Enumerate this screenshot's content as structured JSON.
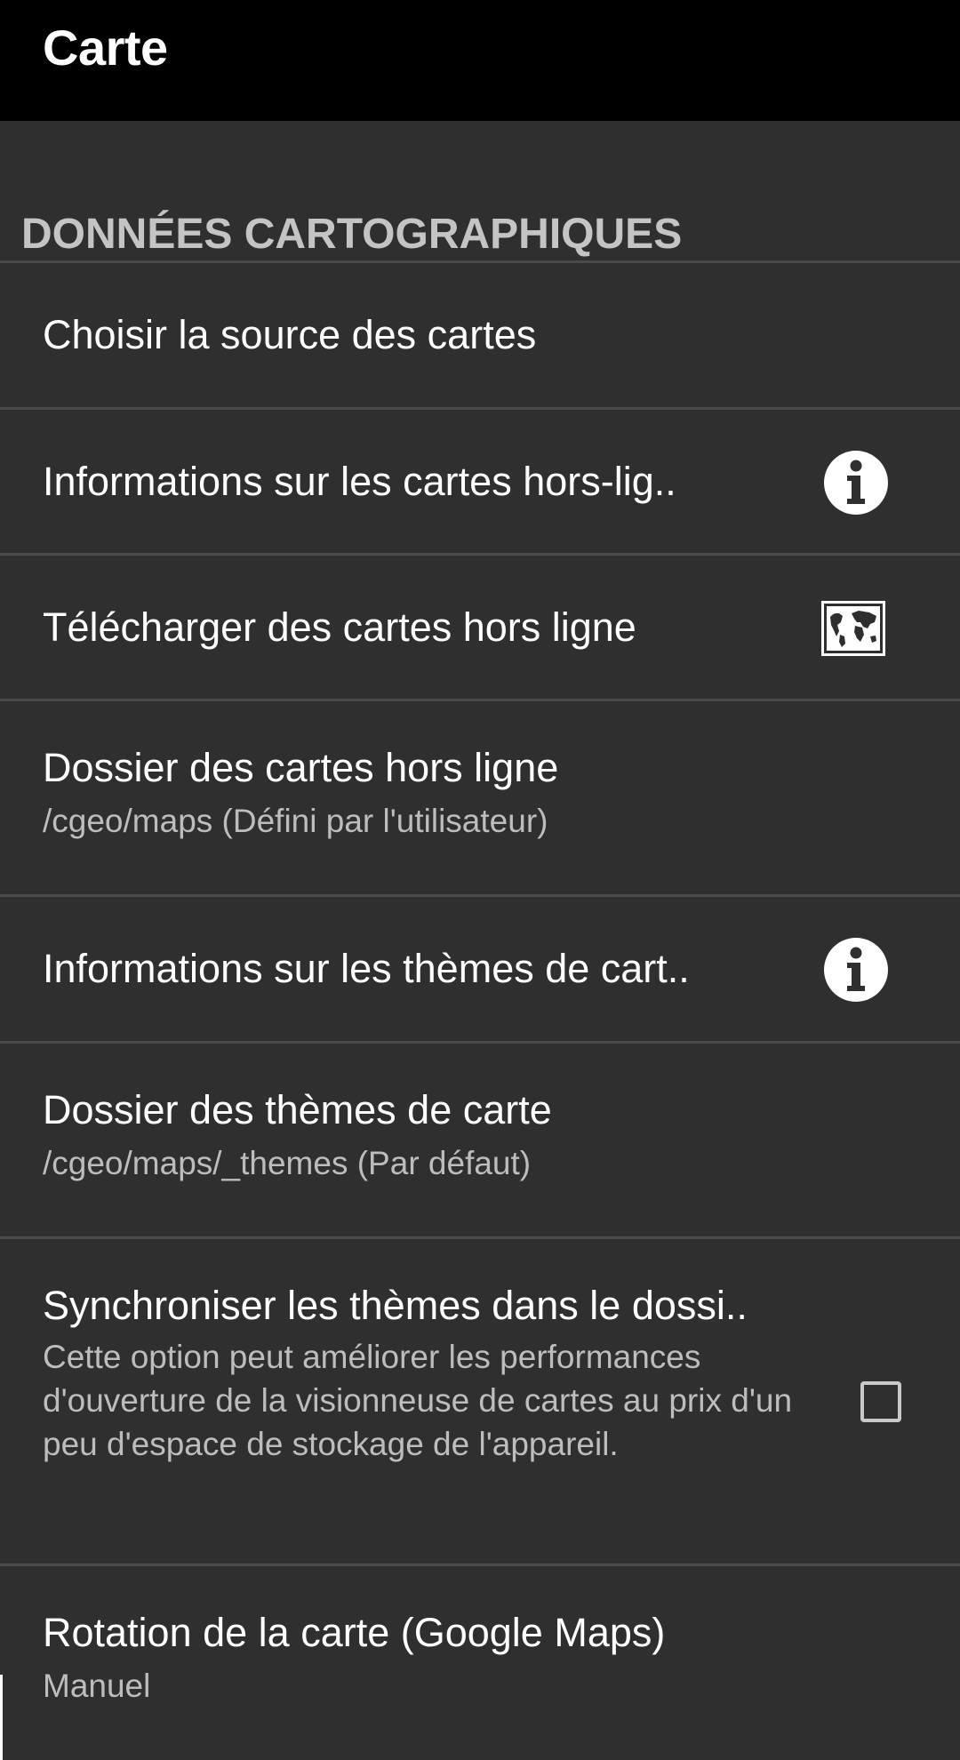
{
  "appbar": {
    "title": "Carte"
  },
  "section": {
    "header": "DONNÉES CARTOGRAPHIQUES"
  },
  "items": [
    {
      "title": "Choisir la source des cartes"
    },
    {
      "title": "Informations sur les cartes hors-lig..",
      "icon": "info-icon"
    },
    {
      "title": "Télécharger des cartes hors ligne",
      "icon": "world-map-icon"
    },
    {
      "title": "Dossier des cartes hors ligne",
      "summary": "/cgeo/maps (Défini par l'utilisateur)"
    },
    {
      "title": "Informations sur les thèmes de cart..",
      "icon": "info-icon"
    },
    {
      "title": "Dossier des thèmes de carte",
      "summary": "/cgeo/maps/_themes (Par défaut)"
    },
    {
      "title": "Synchroniser les thèmes dans le dossi..",
      "summary": "Cette option peut améliorer les performances d'ouverture de la visionneuse de cartes au prix d'un peu d'espace de stockage de l'appareil.",
      "checked": false
    },
    {
      "title": "Rotation de la carte (Google Maps)",
      "summary": "Manuel"
    }
  ],
  "colors": {
    "appbar_bg": "#000000",
    "background": "#2f2f2f",
    "divider": "#4a4a4a",
    "section_header": "#c4c4c4",
    "title_text": "#ffffff",
    "summary_text": "#bdbdbd"
  }
}
